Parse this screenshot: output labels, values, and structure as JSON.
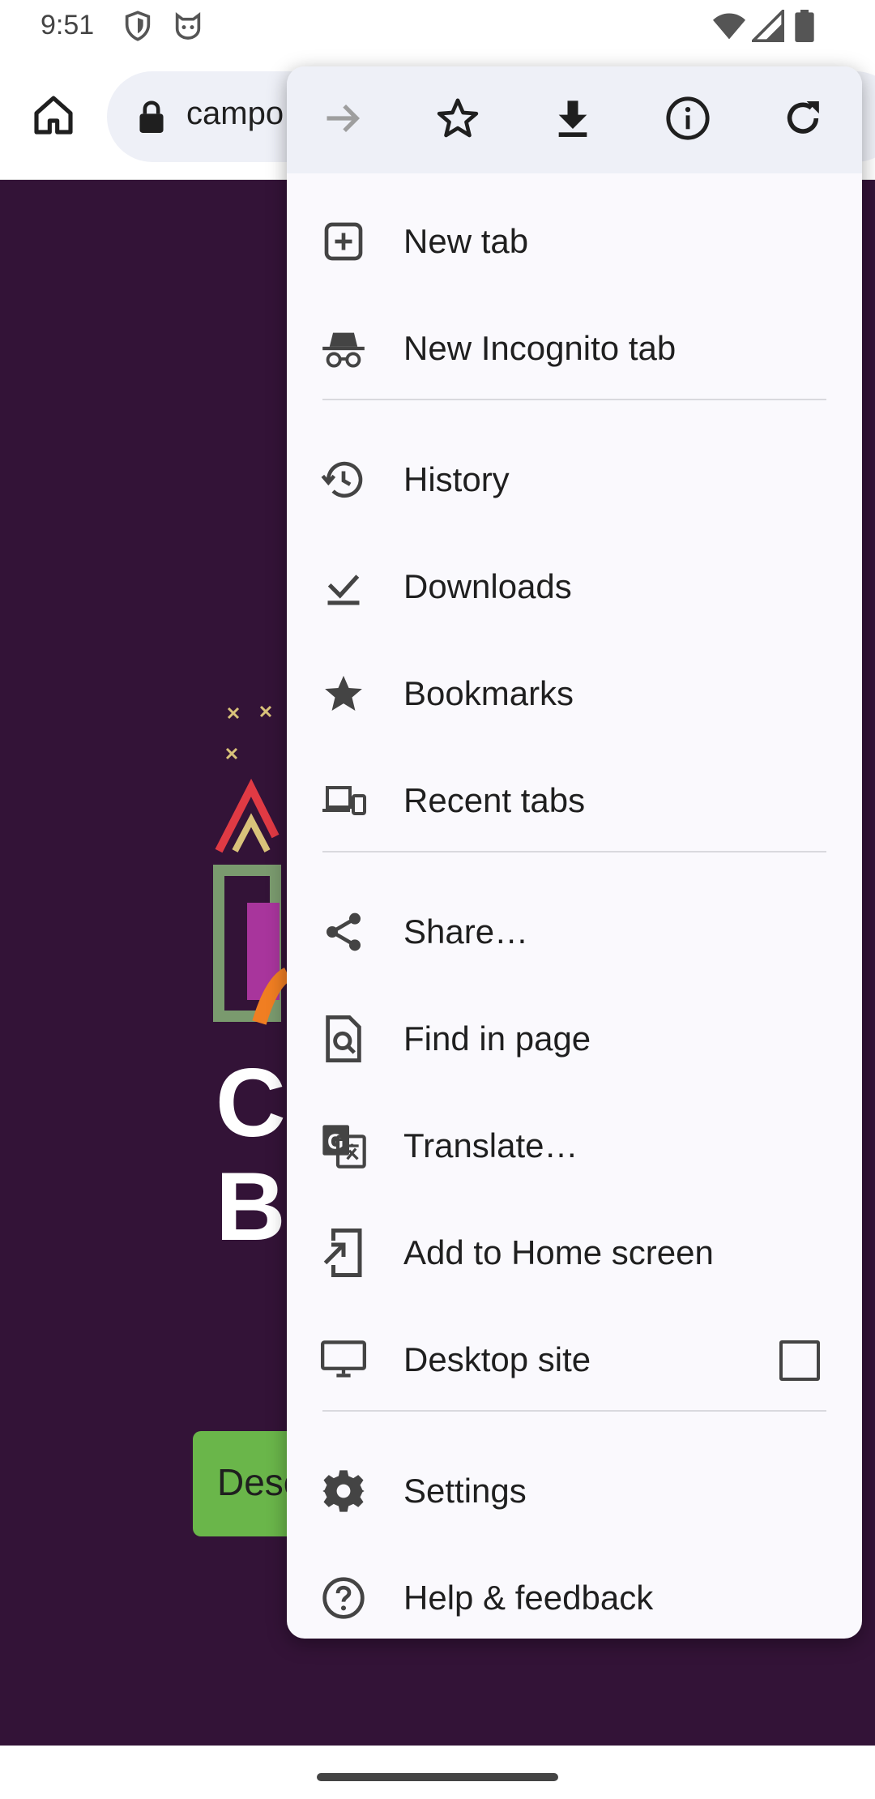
{
  "status_bar": {
    "time": "9:51",
    "icons": [
      "shield-icon",
      "cat-icon",
      "wifi-icon",
      "signal-icon",
      "battery-icon"
    ]
  },
  "toolbar": {
    "url": "campo",
    "home_icon": "home-icon",
    "lock_icon": "lock-icon"
  },
  "page": {
    "background": "#331337",
    "button_text": "Desc",
    "button_color": "#6ab64a"
  },
  "menu": {
    "action_bar": [
      "forward-icon",
      "bookmark-star-icon",
      "download-icon",
      "info-icon",
      "refresh-icon"
    ],
    "items": [
      {
        "label": "New tab",
        "icon": "new-tab-icon"
      },
      {
        "label": "New Incognito tab",
        "icon": "incognito-icon"
      },
      {
        "label": "History",
        "icon": "history-icon"
      },
      {
        "label": "Downloads",
        "icon": "downloads-icon"
      },
      {
        "label": "Bookmarks",
        "icon": "bookmarks-icon"
      },
      {
        "label": "Recent tabs",
        "icon": "recent-tabs-icon"
      },
      {
        "label": "Share…",
        "icon": "share-icon"
      },
      {
        "label": "Find in page",
        "icon": "find-in-page-icon"
      },
      {
        "label": "Translate…",
        "icon": "translate-icon"
      },
      {
        "label": "Add to Home screen",
        "icon": "add-to-home-icon"
      },
      {
        "label": "Desktop site",
        "icon": "desktop-icon",
        "checkbox_checked": false
      },
      {
        "label": "Settings",
        "icon": "settings-icon"
      },
      {
        "label": "Help & feedback",
        "icon": "help-icon"
      }
    ]
  }
}
